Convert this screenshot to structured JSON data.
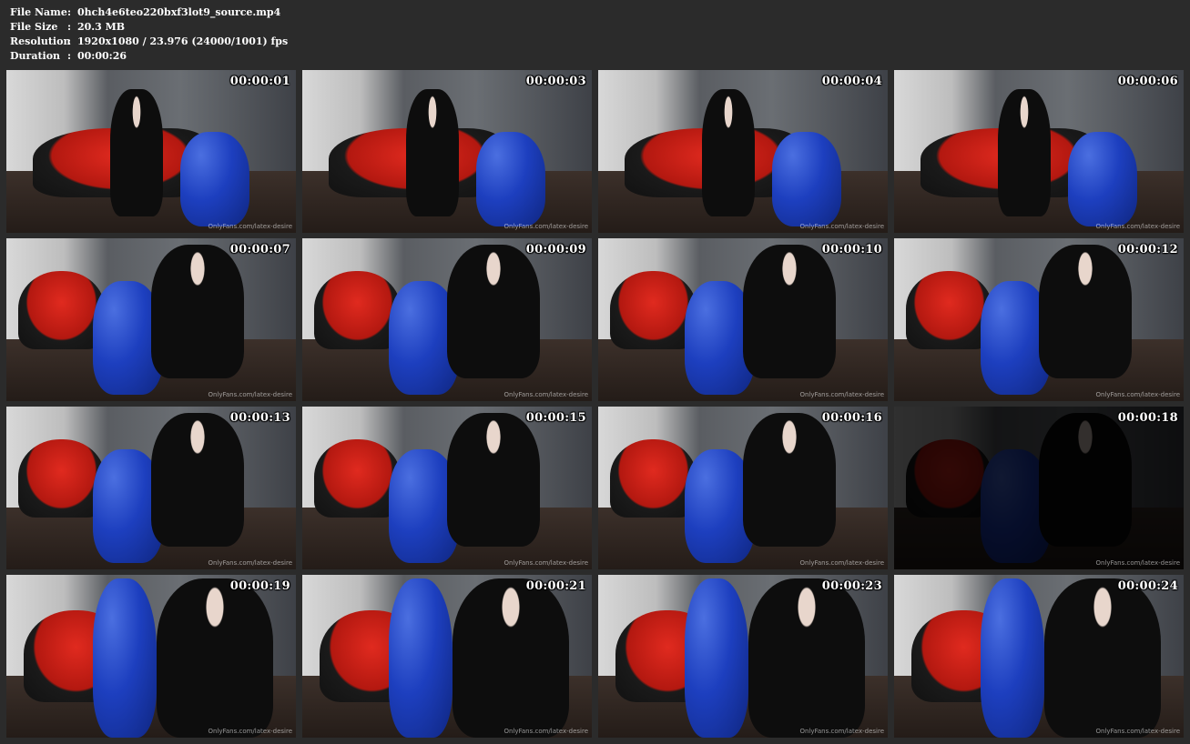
{
  "info": {
    "rows": [
      {
        "key": "File Name",
        "sep": ":",
        "value": "0hch4e6teo220bxf3lot9_source.mp4"
      },
      {
        "key": "File Size",
        "sep": ":",
        "value": "20.3 MB"
      },
      {
        "key": "Resolution",
        "sep": ":",
        "value": "1920x1080 / 23.976 (24000/1001) fps"
      },
      {
        "key": "Duration",
        "sep": ":",
        "value": "00:00:26"
      }
    ]
  },
  "thumbnails": [
    {
      "time": "00:00:01",
      "watermark": "OnlyFans.com/latex-desire"
    },
    {
      "time": "00:00:03",
      "watermark": "OnlyFans.com/latex-desire"
    },
    {
      "time": "00:00:04",
      "watermark": "OnlyFans.com/latex-desire"
    },
    {
      "time": "00:00:06",
      "watermark": "OnlyFans.com/latex-desire"
    },
    {
      "time": "00:00:07",
      "watermark": "OnlyFans.com/latex-desire"
    },
    {
      "time": "00:00:09",
      "watermark": "OnlyFans.com/latex-desire"
    },
    {
      "time": "00:00:10",
      "watermark": "OnlyFans.com/latex-desire"
    },
    {
      "time": "00:00:12",
      "watermark": "OnlyFans.com/latex-desire"
    },
    {
      "time": "00:00:13",
      "watermark": "OnlyFans.com/latex-desire"
    },
    {
      "time": "00:00:15",
      "watermark": "OnlyFans.com/latex-desire"
    },
    {
      "time": "00:00:16",
      "watermark": "OnlyFans.com/latex-desire"
    },
    {
      "time": "00:00:18",
      "watermark": "OnlyFans.com/latex-desire"
    },
    {
      "time": "00:00:19",
      "watermark": "OnlyFans.com/latex-desire"
    },
    {
      "time": "00:00:21",
      "watermark": "OnlyFans.com/latex-desire"
    },
    {
      "time": "00:00:23",
      "watermark": "OnlyFans.com/latex-desire"
    },
    {
      "time": "00:00:24",
      "watermark": "OnlyFans.com/latex-desire"
    }
  ]
}
